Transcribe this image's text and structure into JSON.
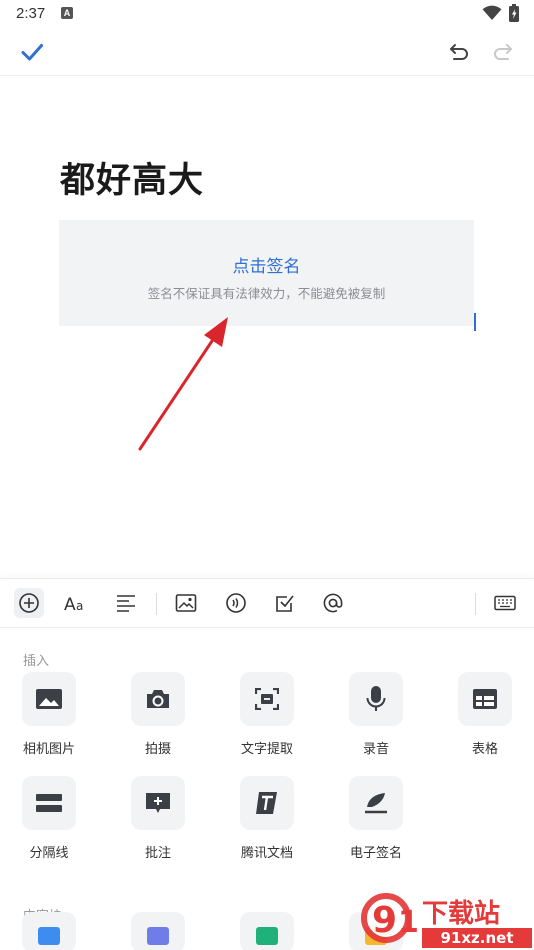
{
  "status_bar": {
    "time": "2:37",
    "badge": "A"
  },
  "document": {
    "title": "都好高大",
    "signature": {
      "link_text": "点击签名",
      "note": "签名不保证具有法律效力，不能避免被复制"
    }
  },
  "insert_panel": {
    "section_insert": "插入",
    "section_content": "内容块",
    "items": [
      {
        "label": "相机图片",
        "icon": "image-icon"
      },
      {
        "label": "拍摄",
        "icon": "camera-icon"
      },
      {
        "label": "文字提取",
        "icon": "text-extract-icon"
      },
      {
        "label": "录音",
        "icon": "microphone-icon"
      },
      {
        "label": "表格",
        "icon": "table-icon"
      },
      {
        "label": "分隔线",
        "icon": "divider-icon"
      },
      {
        "label": "批注",
        "icon": "comment-icon"
      },
      {
        "label": "腾讯文档",
        "icon": "tencent-docs-icon"
      },
      {
        "label": "电子签名",
        "icon": "signature-icon"
      }
    ]
  },
  "watermark": {
    "logo_text": "91下载站",
    "site": "91xz.net"
  },
  "colors": {
    "accent": "#2f6fd6",
    "arrow": "#d9262c",
    "tile_bg": "#f2f3f5"
  }
}
